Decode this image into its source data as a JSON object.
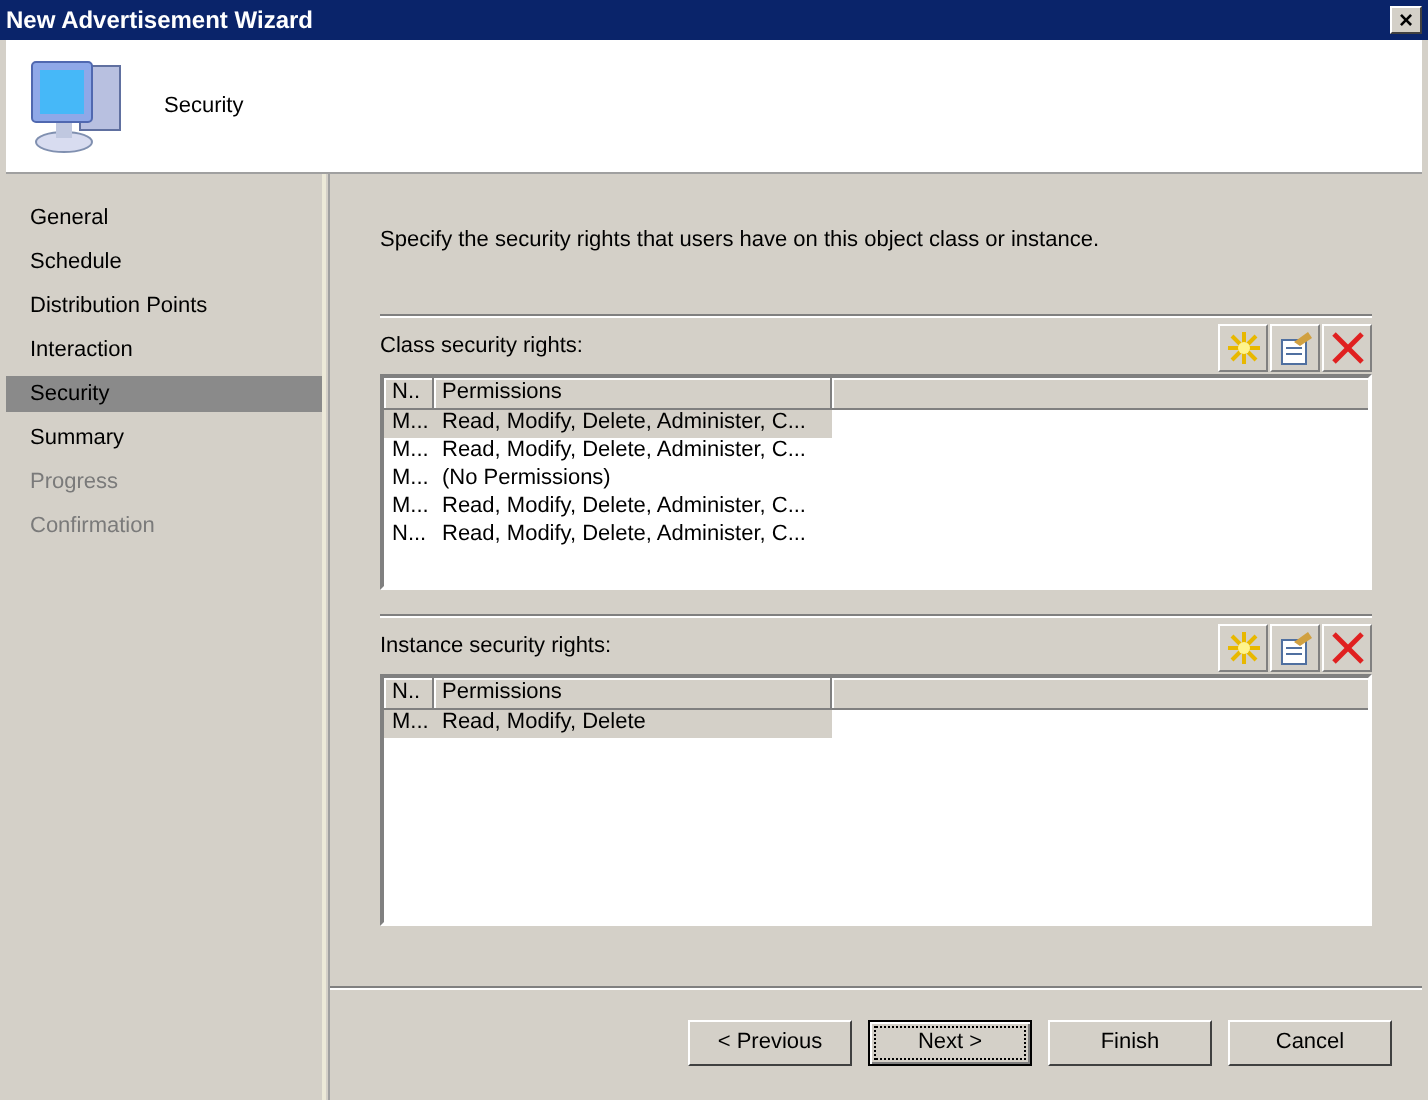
{
  "window": {
    "title": "New Advertisement Wizard",
    "close": "×"
  },
  "header": {
    "title": "Security"
  },
  "sidebar": {
    "items": [
      {
        "label": "General",
        "selected": false,
        "disabled": false
      },
      {
        "label": "Schedule",
        "selected": false,
        "disabled": false
      },
      {
        "label": "Distribution Points",
        "selected": false,
        "disabled": false
      },
      {
        "label": "Interaction",
        "selected": false,
        "disabled": false
      },
      {
        "label": "Security",
        "selected": true,
        "disabled": false
      },
      {
        "label": "Summary",
        "selected": false,
        "disabled": false
      },
      {
        "label": "Progress",
        "selected": false,
        "disabled": true
      },
      {
        "label": "Confirmation",
        "selected": false,
        "disabled": true
      }
    ]
  },
  "description": "Specify the security rights that users have on this object class or instance.",
  "sections": [
    {
      "label": "Class security rights:",
      "columns": [
        "N..",
        "Permissions"
      ],
      "rows": [
        {
          "cells": [
            "M...",
            "Read, Modify, Delete, Administer, C..."
          ],
          "selected": true
        },
        {
          "cells": [
            "M...",
            "Read, Modify, Delete, Administer, C..."
          ],
          "selected": false
        },
        {
          "cells": [
            "M...",
            "(No Permissions)"
          ],
          "selected": false
        },
        {
          "cells": [
            "M...",
            "Read, Modify, Delete, Administer, C..."
          ],
          "selected": false
        },
        {
          "cells": [
            "N...",
            "Read, Modify, Delete, Administer, C..."
          ],
          "selected": false
        }
      ]
    },
    {
      "label": "Instance security rights:",
      "columns": [
        "N..",
        "Permissions"
      ],
      "rows": [
        {
          "cells": [
            "M...",
            "Read, Modify, Delete"
          ],
          "selected": true
        }
      ]
    }
  ],
  "buttons": [
    {
      "label": "< Previous",
      "default": false
    },
    {
      "label": "Next >",
      "default": true
    },
    {
      "label": "Finish",
      "default": false
    },
    {
      "label": "Cancel",
      "default": false
    }
  ]
}
